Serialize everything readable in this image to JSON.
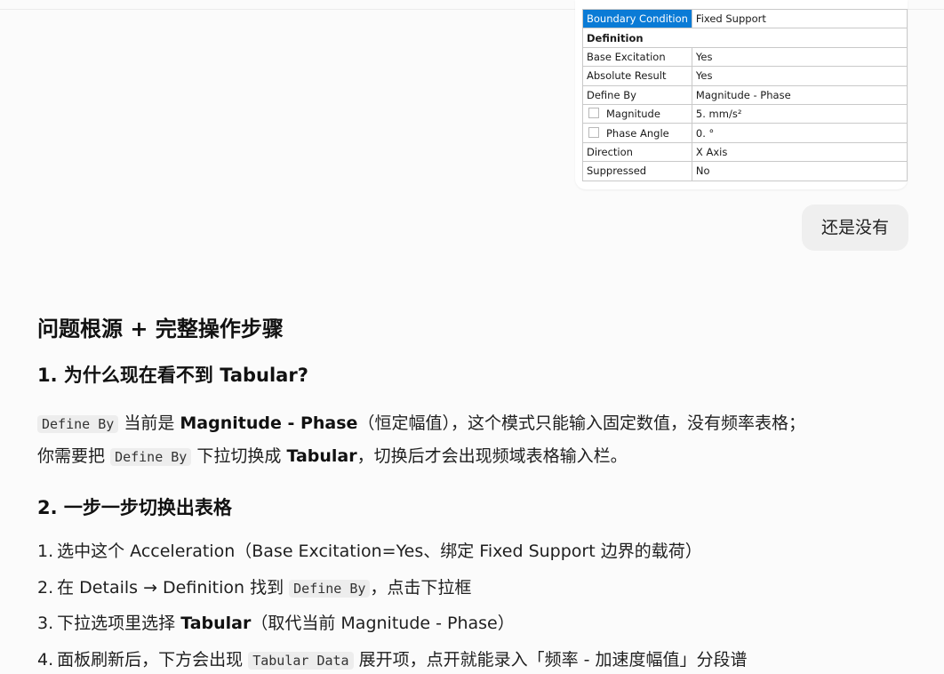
{
  "details": {
    "rows": [
      {
        "key": "Boundary Condition",
        "value": "Fixed Support",
        "highlight": true
      },
      {
        "section": "Definition"
      },
      {
        "key": "Base Excitation",
        "value": "Yes"
      },
      {
        "key": "Absolute Result",
        "value": "Yes"
      },
      {
        "key": "Define By",
        "value": "Magnitude - Phase"
      },
      {
        "key": "Magnitude",
        "value": "5. mm/s²",
        "checkbox": true
      },
      {
        "key": "Phase Angle",
        "value": "0. °",
        "checkbox": true
      },
      {
        "key": "Direction",
        "value": "X Axis"
      },
      {
        "key": "Suppressed",
        "value": "No"
      }
    ]
  },
  "user_message": "还是没有",
  "answer": {
    "title": "问题根源 + 完整操作步骤",
    "h1": "1. 为什么现在看不到 Tabular?",
    "p1": {
      "code": "Define By",
      "t1": "当前是",
      "bold": "Magnitude - Phase",
      "t2": "（恒定幅值），这个模式只能输入固定数值，没有频率表格；"
    },
    "p2": {
      "t1": "你需要把",
      "code": "Define By",
      "t2": "下拉切换成",
      "bold": "Tabular",
      "t3": "，切换后才会出现频域表格输入栏。"
    },
    "h2": "2. 一步一步切换出表格",
    "steps": [
      {
        "num": "1.",
        "t1": "选中这个 Acceleration（Base Excitation=Yes、绑定 Fixed Support 边界的载荷）"
      },
      {
        "num": "2.",
        "t1": "在 Details → Definition 找到",
        "code": "Define By",
        "t2": "，点击下拉框"
      },
      {
        "num": "3.",
        "t1": "下拉选项里选择",
        "bold": "Tabular",
        "t2": "（取代当前 Magnitude - Phase）"
      },
      {
        "num": "4.",
        "t1": "面板刷新后，下方会出现",
        "code": "Tabular Data",
        "t2": "展开项，点开就能录入「频率 - 加速度幅值」分段谱"
      }
    ]
  }
}
